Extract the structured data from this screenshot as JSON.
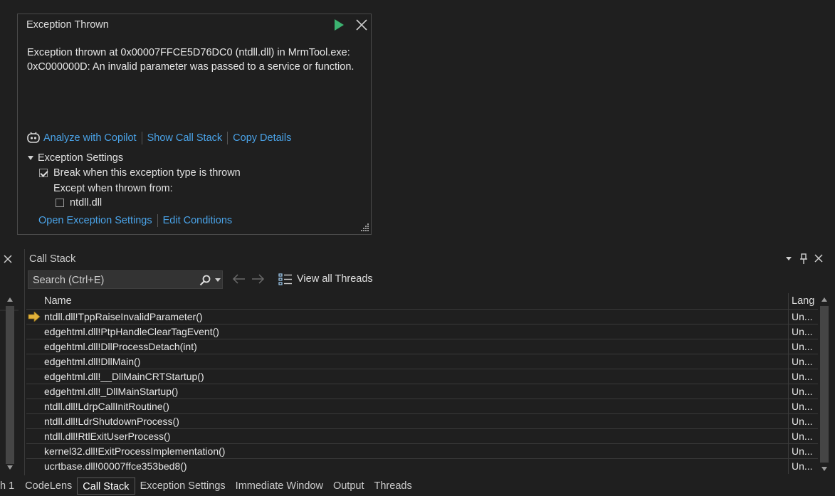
{
  "exception": {
    "title": "Exception Thrown",
    "message_line1": "Exception thrown at 0x00007FFCE5D76DC0 (ntdll.dll) in MrmTool.exe:",
    "message_line2": "0xC000000D: An invalid parameter was passed to a service or function.",
    "links": [
      "Analyze with Copilot",
      "Show Call Stack",
      "Copy Details"
    ],
    "settings_header": "Exception Settings",
    "break_label": "Break when this exception type is thrown",
    "break_checked": true,
    "except_label": "Except when thrown from:",
    "module_label": "ntdll.dll",
    "module_checked": false,
    "bottom_links": [
      "Open Exception Settings",
      "Edit Conditions"
    ]
  },
  "callstack": {
    "title": "Call Stack",
    "search_placeholder": "Search (Ctrl+E)",
    "view_all_threads": "View all Threads",
    "columns": {
      "name": "Name",
      "lang": "Lang"
    },
    "rows": [
      {
        "name": "ntdll.dll!TppRaiseInvalidParameter()",
        "lang": "Un...",
        "current": true
      },
      {
        "name": "edgehtml.dll!PtpHandleClearTagEvent()",
        "lang": "Un..."
      },
      {
        "name": "edgehtml.dll!DllProcessDetach(int)",
        "lang": "Un..."
      },
      {
        "name": "edgehtml.dll!DllMain()",
        "lang": "Un..."
      },
      {
        "name": "edgehtml.dll!__DllMainCRTStartup()",
        "lang": "Un..."
      },
      {
        "name": "edgehtml.dll!_DllMainStartup()",
        "lang": "Un..."
      },
      {
        "name": "ntdll.dll!LdrpCallInitRoutine()",
        "lang": "Un..."
      },
      {
        "name": "ntdll.dll!LdrShutdownProcess()",
        "lang": "Un..."
      },
      {
        "name": "ntdll.dll!RtlExitUserProcess()",
        "lang": "Un..."
      },
      {
        "name": "kernel32.dll!ExitProcessImplementation()",
        "lang": "Un..."
      },
      {
        "name": "ucrtbase.dll!00007ffce353bed8()",
        "lang": "Un..."
      }
    ]
  },
  "left_panel_tab_fragment": "h 1",
  "tabs": [
    "CodeLens",
    "Call Stack",
    "Exception Settings",
    "Immediate Window",
    "Output",
    "Threads"
  ],
  "active_tab": "Call Stack",
  "colors": {
    "link": "#4aa3e8",
    "play": "#3cb371",
    "arrow": "#e2b23a"
  }
}
